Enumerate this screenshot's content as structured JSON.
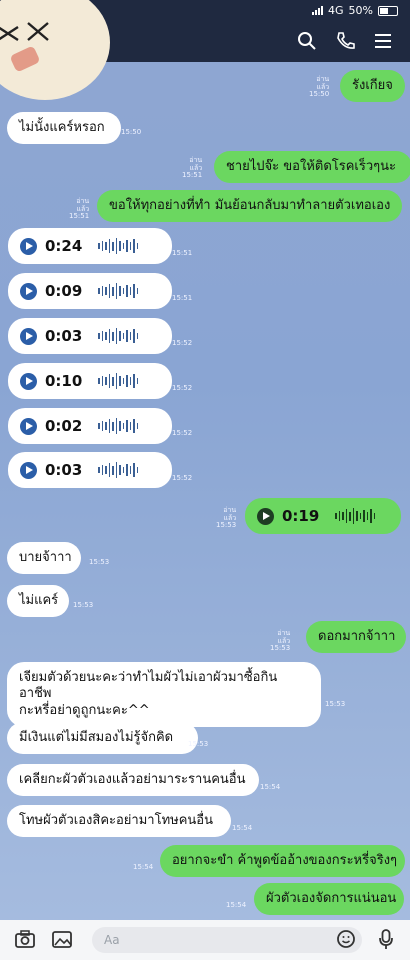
{
  "status": {
    "network": "4G",
    "battery": "50%"
  },
  "header": {
    "icons": [
      "search-icon",
      "phone-icon",
      "menu-icon"
    ]
  },
  "messages": [
    {
      "type": "out",
      "text": "รังเกียจ",
      "read": "อ่านแล้ว",
      "time": "15:50"
    },
    {
      "type": "in",
      "text": "ไม่นั้งแคร์หรอก",
      "time": "15:50"
    },
    {
      "type": "out",
      "text": "ชายไปจ๊ะ ขอให้ติดโรคเร็วๆนะ",
      "read": "อ่านแล้ว",
      "time": "15:51"
    },
    {
      "type": "out",
      "text": "ขอให้ทุกอย่างที่ทำ มันย้อนกลับมาทำลายตัวเทอเอง",
      "read": "อ่านแล้ว",
      "time": "15:51"
    },
    {
      "type": "in",
      "voice": "0:24",
      "time": "15:51"
    },
    {
      "type": "in",
      "voice": "0:09",
      "time": "15:51"
    },
    {
      "type": "in",
      "voice": "0:03",
      "time": "15:52"
    },
    {
      "type": "in",
      "voice": "0:10",
      "time": "15:52"
    },
    {
      "type": "in",
      "voice": "0:02",
      "time": "15:52"
    },
    {
      "type": "in",
      "voice": "0:03",
      "time": "15:52"
    },
    {
      "type": "out",
      "voice": "0:19",
      "read": "อ่านแล้ว",
      "time": "15:53"
    },
    {
      "type": "in",
      "text": "บายจ้าาา",
      "time": "15:53"
    },
    {
      "type": "in",
      "text": "ไม่แคร์",
      "time": "15:53"
    },
    {
      "type": "out",
      "text": "ดอกมากจ้าาา",
      "read": "อ่านแล้ว",
      "time": "15:53"
    },
    {
      "type": "in",
      "text": "เจียมตัวด้วยนะคะว่าทำไมผัวไม่เอาผัวมาซื้อกินอาชีพ",
      "text2": "กะหรี่อย่าดูถูกนะคะ^^",
      "time": "15:53"
    },
    {
      "type": "in",
      "text": "มีเงินแต่ไม่มีสมองไม่รู้จักคิด",
      "time": "15:53"
    },
    {
      "type": "in",
      "text": "เคลียกะผัวตัวเองแล้วอย่ามาระรานคนอื่น",
      "time": "15:54"
    },
    {
      "type": "in",
      "text": "โทษผัวตัวเองสิคะอย่ามาโทษคนอื่น",
      "time": "15:54"
    },
    {
      "type": "out",
      "text": "อยากจะขำ ค้าพูดข้ออ้างของกระหรี่จริงๆ",
      "time": "15:54"
    },
    {
      "type": "out",
      "text": "ผัวตัวเองจัดการแน่นอน",
      "time": "15:54"
    }
  ],
  "input": {
    "placeholder": "Aa"
  }
}
